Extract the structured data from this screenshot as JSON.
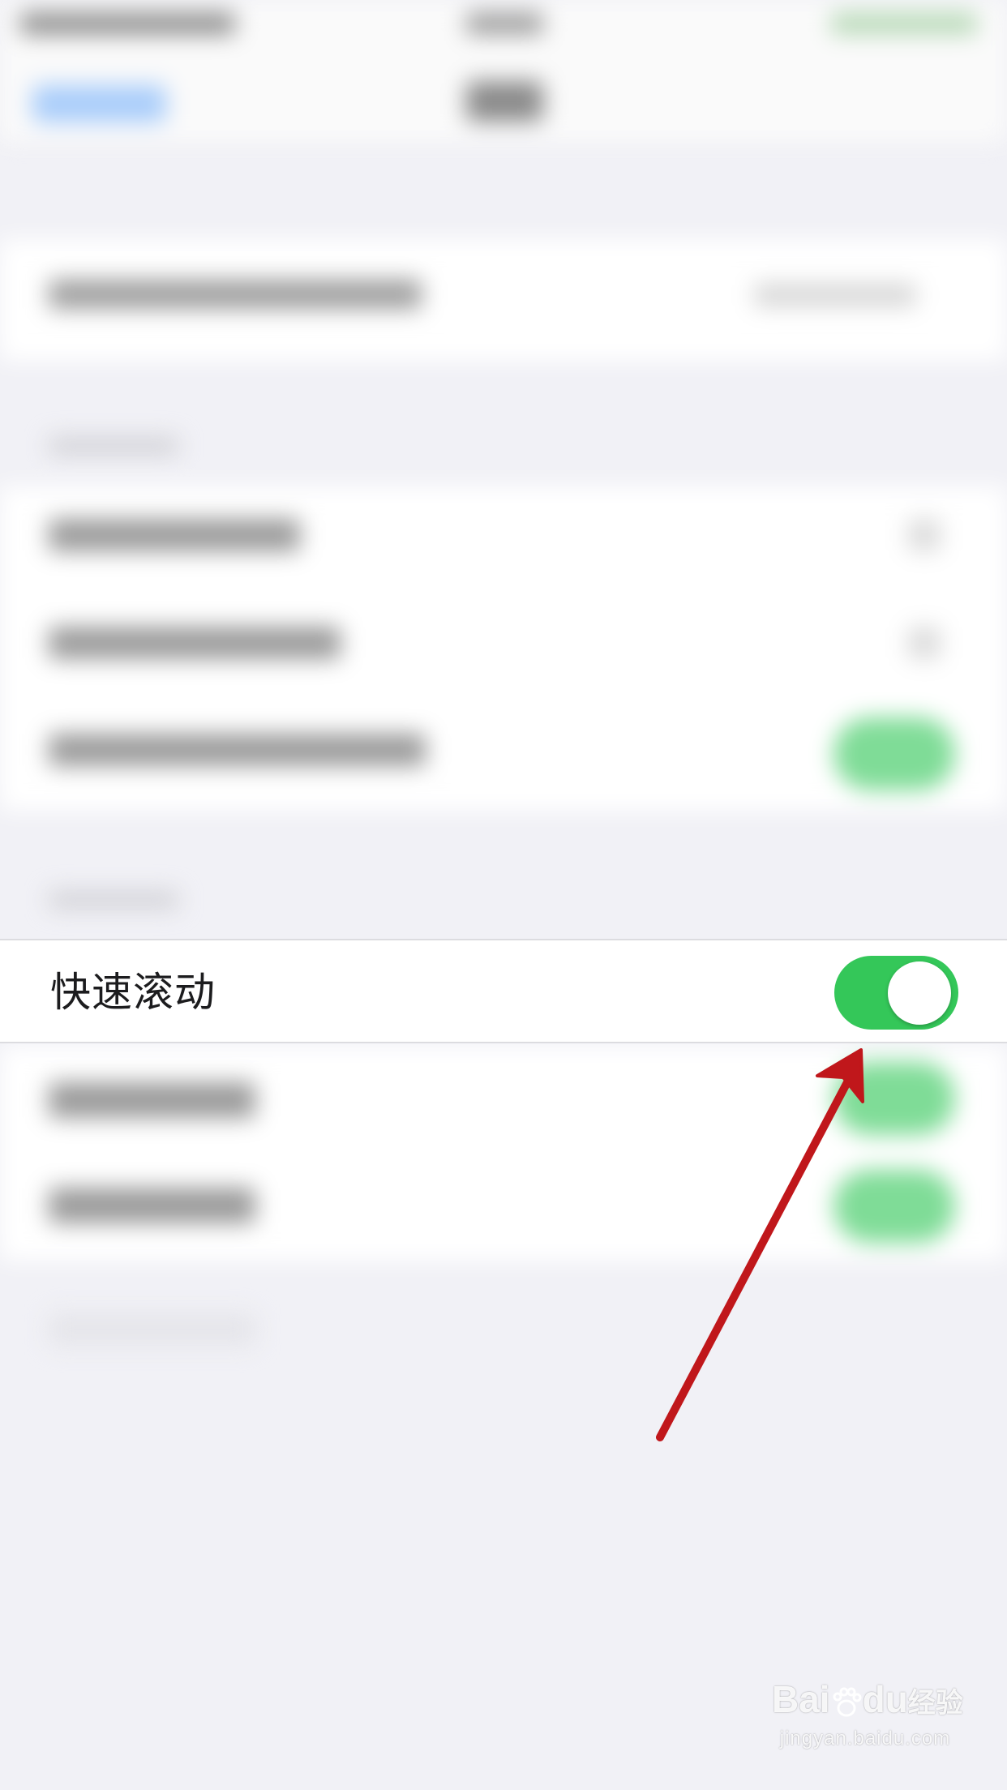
{
  "setting": {
    "label": "快速滚动",
    "enabled": true
  },
  "colors": {
    "background": "#f1f1f6",
    "toggle_on": "#34c759",
    "arrow": "#c0171b"
  },
  "watermark": {
    "brand_left": "Bai",
    "brand_right": "du",
    "brand_suffix": "经验",
    "url": "jingyan.baidu.com"
  }
}
